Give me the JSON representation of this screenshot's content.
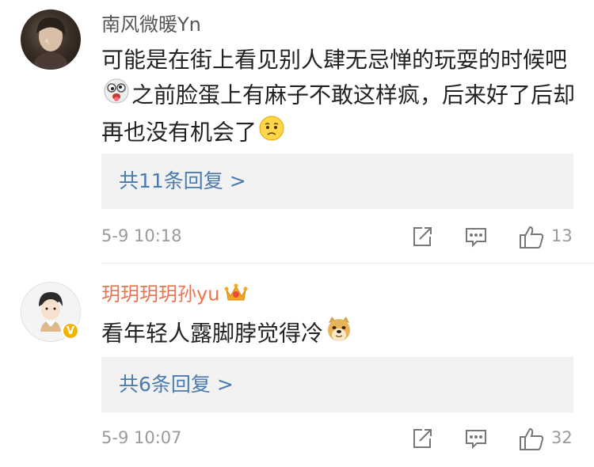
{
  "comments": [
    {
      "username": "南风微暖Yn",
      "text_1": "可能是在街上看见别人肆无忌惮的玩耍的时候吧",
      "text_2": "之前脸蛋上有麻子不敢这样疯，后来好了后却再也没有机会了",
      "replies_label": "共11条回复 >",
      "time": "5-9 10:18",
      "likes": "13",
      "emoji_1": "crazy-face-emoji",
      "emoji_2": "sad-face-emoji"
    },
    {
      "username": "玥玥玥玥孙yu",
      "text_1": "看年轻人露脚脖觉得冷",
      "replies_label": "共6条回复 >",
      "time": "5-9 10:07",
      "likes": "32",
      "badge": "crown-badge",
      "emoji_1": "doge-emoji",
      "verified": true
    }
  ],
  "colors": {
    "username_vip": "#eb7350",
    "username_normal": "#555555",
    "reply_link": "#4a7bb0",
    "meta_gray": "#9a9a9a",
    "reply_bg": "#f2f2f2",
    "verify_badge": "#f3b400"
  }
}
